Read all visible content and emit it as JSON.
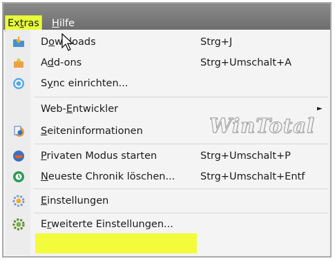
{
  "menubar": {
    "items": [
      {
        "label": "Extras",
        "mnemonic_index": 2,
        "active": true
      },
      {
        "label": "Hilfe",
        "mnemonic_index": 0,
        "active": false
      }
    ]
  },
  "menu": {
    "items": [
      {
        "icon": "downloads-icon",
        "label": "Downloads",
        "mnemonic_index": 1,
        "shortcut": "Strg+J"
      },
      {
        "icon": "addons-icon",
        "label": "Add-ons",
        "mnemonic_index": 1,
        "shortcut": "Strg+Umschalt+A"
      },
      {
        "icon": "sync-icon",
        "label": "Sync einrichten...",
        "mnemonic_index": 1,
        "shortcut": ""
      },
      {
        "icon": "",
        "label": "Web-Entwickler",
        "mnemonic_index": 4,
        "shortcut": "",
        "submenu": true
      },
      {
        "icon": "page-info-icon",
        "label": "Seiteninformationen",
        "mnemonic_index": 0,
        "shortcut": ""
      },
      {
        "icon": "private-mode-icon",
        "label": "Privaten Modus starten",
        "mnemonic_index": 0,
        "shortcut": "Strg+Umschalt+P"
      },
      {
        "icon": "clear-history-icon",
        "label": "Neueste Chronik löschen...",
        "mnemonic_index": 0,
        "shortcut": "Strg+Umschalt+Entf"
      },
      {
        "icon": "settings-icon",
        "label": "Einstellungen",
        "mnemonic_index": 0,
        "shortcut": ""
      },
      {
        "icon": "advanced-settings-icon",
        "label": "Erweiterte Einstellungen...",
        "mnemonic_index": 1,
        "shortcut": "",
        "highlighted": true
      }
    ]
  },
  "watermark": "WinTotal",
  "colors": {
    "highlight": "#f2fb3c",
    "menubar": "#7a7a7a"
  }
}
